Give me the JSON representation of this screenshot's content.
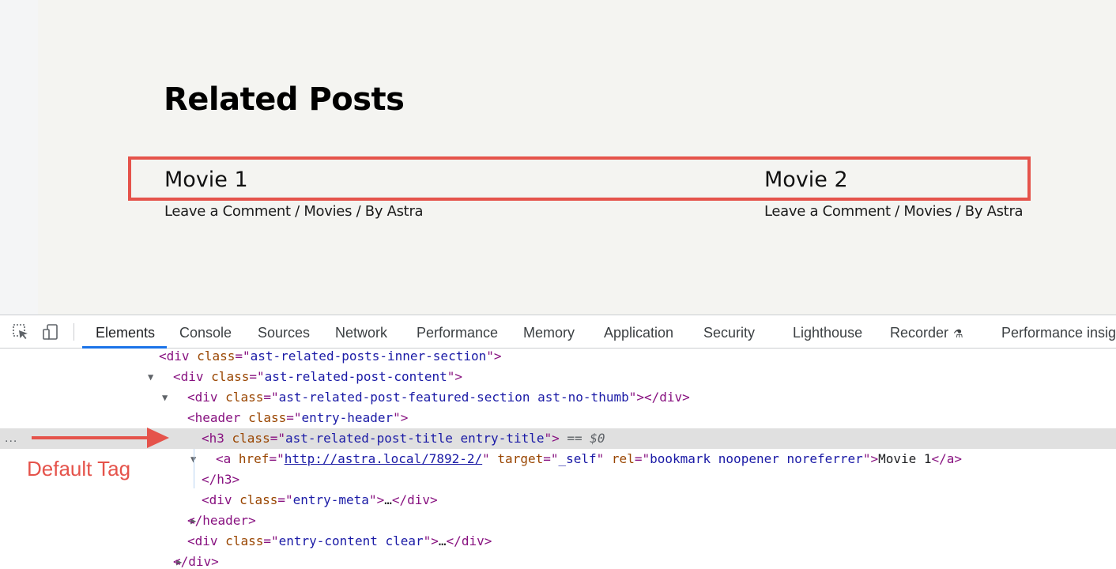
{
  "page": {
    "heading": "Related Posts",
    "posts": [
      {
        "title": "Movie 1",
        "meta": "Leave a Comment / Movies / By Astra"
      },
      {
        "title": "Movie 2",
        "meta": "Leave a Comment / Movies / By Astra"
      }
    ]
  },
  "devtools": {
    "tabs": [
      "Elements",
      "Console",
      "Sources",
      "Network",
      "Performance",
      "Memory",
      "Application",
      "Security",
      "Lighthouse",
      "Recorder",
      "Performance insigh"
    ],
    "active_tab": "Elements",
    "tree": {
      "r0": {
        "tag_open": "<div ",
        "attr": "class",
        "eq": "=\"",
        "val": "ast-related-posts-inner-section",
        "close": "\">"
      },
      "r1": {
        "tag_open": "<div ",
        "attr": "class",
        "eq": "=\"",
        "val": "ast-related-post-content",
        "close": "\">"
      },
      "r2": {
        "tag_open": "<div ",
        "attr": "class",
        "eq": "=\"",
        "val": "ast-related-post-featured-section ast-no-thumb",
        "close": "\"></div>"
      },
      "r3": {
        "tag_open": "<header ",
        "attr": "class",
        "eq": "=\"",
        "val": "entry-header",
        "close": "\">"
      },
      "r4": {
        "tag_open": "<h3 ",
        "attr": "class",
        "eq": "=\"",
        "val": "ast-related-post-title entry-title",
        "close": "\">",
        "console_ref": " == $0"
      },
      "r5": {
        "tag_open": "<a ",
        "href_attr": "href",
        "href_val": "http://astra.local/7892-2/",
        "target_attr": "target",
        "target_val": "_self",
        "rel_attr": "rel",
        "rel_val": "bookmark noopener noreferrer",
        "text": "Movie 1",
        "tag_close": "</a>"
      },
      "r6": {
        "tag_close": "</h3>"
      },
      "r7": {
        "tag_open": "<div ",
        "attr": "class",
        "eq": "=\"",
        "val": "entry-meta",
        "close": "\">",
        "ellipsis": "…",
        "tag_close": "</div>"
      },
      "r8": {
        "tag_close": "</header>"
      },
      "r9": {
        "tag_open": "<div ",
        "attr": "class",
        "eq": "=\"",
        "val": "entry-content clear",
        "close": "\">",
        "ellipsis": "…",
        "tag_close": "</div>"
      },
      "r10": {
        "tag_close": "</div>"
      }
    },
    "row_menu": "..."
  },
  "annotation": {
    "label": "Default Tag"
  },
  "colors": {
    "highlight": "#e5534b",
    "tab_active_underline": "#1a73e8"
  }
}
